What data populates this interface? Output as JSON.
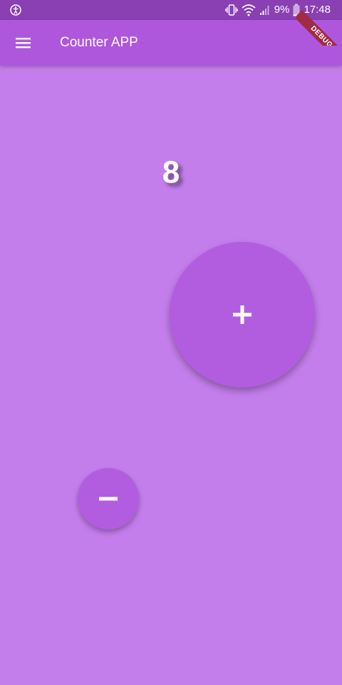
{
  "status_bar": {
    "battery_text": "9%",
    "time": "17:48",
    "icons": [
      "accessibility-icon",
      "vibrate-icon",
      "wifi-icon",
      "signal-icon",
      "battery-icon"
    ]
  },
  "app_bar": {
    "title": "Counter APP",
    "menu_icon": "menu-icon"
  },
  "debug_banner": {
    "label": "DEBUG"
  },
  "counter": {
    "value": "8"
  },
  "buttons": {
    "increment_icon": "plus-icon",
    "decrement_icon": "minus-icon"
  },
  "colors": {
    "background": "#c47eec",
    "app_bar": "#ae57dd",
    "status_bar": "#8a3fb3",
    "button": "#b25ddf",
    "debug_banner": "#a02b45"
  }
}
